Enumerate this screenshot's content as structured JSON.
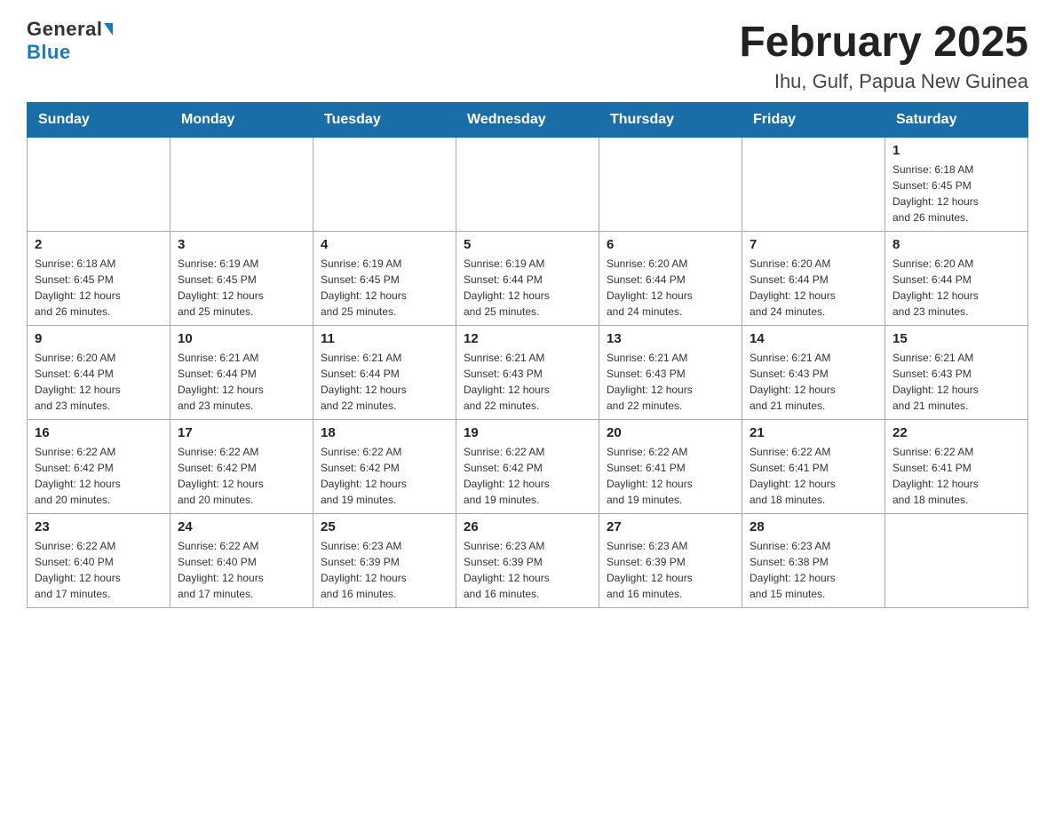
{
  "header": {
    "logo_general": "General",
    "logo_blue": "Blue",
    "title": "February 2025",
    "subtitle": "Ihu, Gulf, Papua New Guinea"
  },
  "weekdays": [
    "Sunday",
    "Monday",
    "Tuesday",
    "Wednesday",
    "Thursday",
    "Friday",
    "Saturday"
  ],
  "weeks": [
    [
      {
        "day": "",
        "info": ""
      },
      {
        "day": "",
        "info": ""
      },
      {
        "day": "",
        "info": ""
      },
      {
        "day": "",
        "info": ""
      },
      {
        "day": "",
        "info": ""
      },
      {
        "day": "",
        "info": ""
      },
      {
        "day": "1",
        "info": "Sunrise: 6:18 AM\nSunset: 6:45 PM\nDaylight: 12 hours\nand 26 minutes."
      }
    ],
    [
      {
        "day": "2",
        "info": "Sunrise: 6:18 AM\nSunset: 6:45 PM\nDaylight: 12 hours\nand 26 minutes."
      },
      {
        "day": "3",
        "info": "Sunrise: 6:19 AM\nSunset: 6:45 PM\nDaylight: 12 hours\nand 25 minutes."
      },
      {
        "day": "4",
        "info": "Sunrise: 6:19 AM\nSunset: 6:45 PM\nDaylight: 12 hours\nand 25 minutes."
      },
      {
        "day": "5",
        "info": "Sunrise: 6:19 AM\nSunset: 6:44 PM\nDaylight: 12 hours\nand 25 minutes."
      },
      {
        "day": "6",
        "info": "Sunrise: 6:20 AM\nSunset: 6:44 PM\nDaylight: 12 hours\nand 24 minutes."
      },
      {
        "day": "7",
        "info": "Sunrise: 6:20 AM\nSunset: 6:44 PM\nDaylight: 12 hours\nand 24 minutes."
      },
      {
        "day": "8",
        "info": "Sunrise: 6:20 AM\nSunset: 6:44 PM\nDaylight: 12 hours\nand 23 minutes."
      }
    ],
    [
      {
        "day": "9",
        "info": "Sunrise: 6:20 AM\nSunset: 6:44 PM\nDaylight: 12 hours\nand 23 minutes."
      },
      {
        "day": "10",
        "info": "Sunrise: 6:21 AM\nSunset: 6:44 PM\nDaylight: 12 hours\nand 23 minutes."
      },
      {
        "day": "11",
        "info": "Sunrise: 6:21 AM\nSunset: 6:44 PM\nDaylight: 12 hours\nand 22 minutes."
      },
      {
        "day": "12",
        "info": "Sunrise: 6:21 AM\nSunset: 6:43 PM\nDaylight: 12 hours\nand 22 minutes."
      },
      {
        "day": "13",
        "info": "Sunrise: 6:21 AM\nSunset: 6:43 PM\nDaylight: 12 hours\nand 22 minutes."
      },
      {
        "day": "14",
        "info": "Sunrise: 6:21 AM\nSunset: 6:43 PM\nDaylight: 12 hours\nand 21 minutes."
      },
      {
        "day": "15",
        "info": "Sunrise: 6:21 AM\nSunset: 6:43 PM\nDaylight: 12 hours\nand 21 minutes."
      }
    ],
    [
      {
        "day": "16",
        "info": "Sunrise: 6:22 AM\nSunset: 6:42 PM\nDaylight: 12 hours\nand 20 minutes."
      },
      {
        "day": "17",
        "info": "Sunrise: 6:22 AM\nSunset: 6:42 PM\nDaylight: 12 hours\nand 20 minutes."
      },
      {
        "day": "18",
        "info": "Sunrise: 6:22 AM\nSunset: 6:42 PM\nDaylight: 12 hours\nand 19 minutes."
      },
      {
        "day": "19",
        "info": "Sunrise: 6:22 AM\nSunset: 6:42 PM\nDaylight: 12 hours\nand 19 minutes."
      },
      {
        "day": "20",
        "info": "Sunrise: 6:22 AM\nSunset: 6:41 PM\nDaylight: 12 hours\nand 19 minutes."
      },
      {
        "day": "21",
        "info": "Sunrise: 6:22 AM\nSunset: 6:41 PM\nDaylight: 12 hours\nand 18 minutes."
      },
      {
        "day": "22",
        "info": "Sunrise: 6:22 AM\nSunset: 6:41 PM\nDaylight: 12 hours\nand 18 minutes."
      }
    ],
    [
      {
        "day": "23",
        "info": "Sunrise: 6:22 AM\nSunset: 6:40 PM\nDaylight: 12 hours\nand 17 minutes."
      },
      {
        "day": "24",
        "info": "Sunrise: 6:22 AM\nSunset: 6:40 PM\nDaylight: 12 hours\nand 17 minutes."
      },
      {
        "day": "25",
        "info": "Sunrise: 6:23 AM\nSunset: 6:39 PM\nDaylight: 12 hours\nand 16 minutes."
      },
      {
        "day": "26",
        "info": "Sunrise: 6:23 AM\nSunset: 6:39 PM\nDaylight: 12 hours\nand 16 minutes."
      },
      {
        "day": "27",
        "info": "Sunrise: 6:23 AM\nSunset: 6:39 PM\nDaylight: 12 hours\nand 16 minutes."
      },
      {
        "day": "28",
        "info": "Sunrise: 6:23 AM\nSunset: 6:38 PM\nDaylight: 12 hours\nand 15 minutes."
      },
      {
        "day": "",
        "info": ""
      }
    ]
  ]
}
